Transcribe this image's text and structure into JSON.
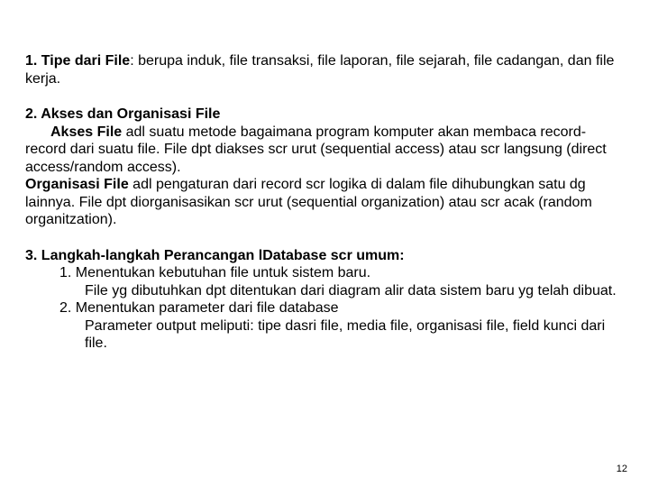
{
  "section1": {
    "lead": "1. Tipe dari File",
    "rest": ": berupa induk, file transaksi, file laporan, file sejarah, file cadangan, dan file kerja."
  },
  "section2": {
    "title": "2. Akses dan Organisasi File",
    "akses_lead": "Akses File",
    "akses_rest": " adl suatu metode bagaimana program komputer akan membaca record-record dari suatu file. File dpt diakses scr urut (sequential access) atau scr langsung (direct access/random access).",
    "org_lead": " Organisasi File",
    "org_rest": " adl pengaturan dari record scr logika di dalam file dihubungkan satu dg lainnya. File dpt diorganisasikan scr urut (sequential organization) atau scr acak (random organitzation)."
  },
  "section3": {
    "title": "3. Langkah-langkah Perancangan lDatabase scr umum:",
    "i1_head": "1. Menentukan kebutuhan file untuk  sistem baru.",
    "i1_body": "File yg dibutuhkan dpt ditentukan dari diagram alir data sistem baru yg telah dibuat.",
    "i2_head": "2. Menentukan parameter dari file database",
    "i2_body": "Parameter output meliputi: tipe dasri file, media file, organisasi file, field kunci dari file."
  },
  "page_number": "12"
}
